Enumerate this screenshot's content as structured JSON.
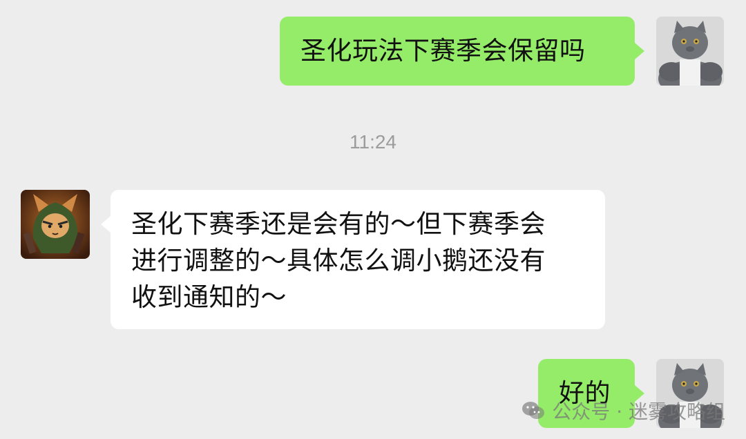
{
  "timestamp": "11:24",
  "messages": [
    {
      "id": "m1",
      "side": "right",
      "text": "圣化玩法下赛季会保留吗",
      "avatar_icon": "cat-avatar-icon"
    },
    {
      "id": "m2",
      "side": "left",
      "text": "圣化下赛季还是会有的～但下赛季会\n进行调整的～具体怎么调小鹅还没有\n收到通知的～",
      "avatar_icon": "fox-warrior-avatar-icon"
    },
    {
      "id": "m3",
      "side": "right",
      "text": "好的",
      "avatar_icon": "cat-avatar-icon"
    }
  ],
  "watermark": {
    "text": "公众号 · 迷雾攻略组",
    "icon": "wechat-icon"
  },
  "colors": {
    "background": "#ededed",
    "outgoing_bubble": "#95ec69",
    "incoming_bubble": "#ffffff",
    "timestamp": "#9c9c9c"
  }
}
